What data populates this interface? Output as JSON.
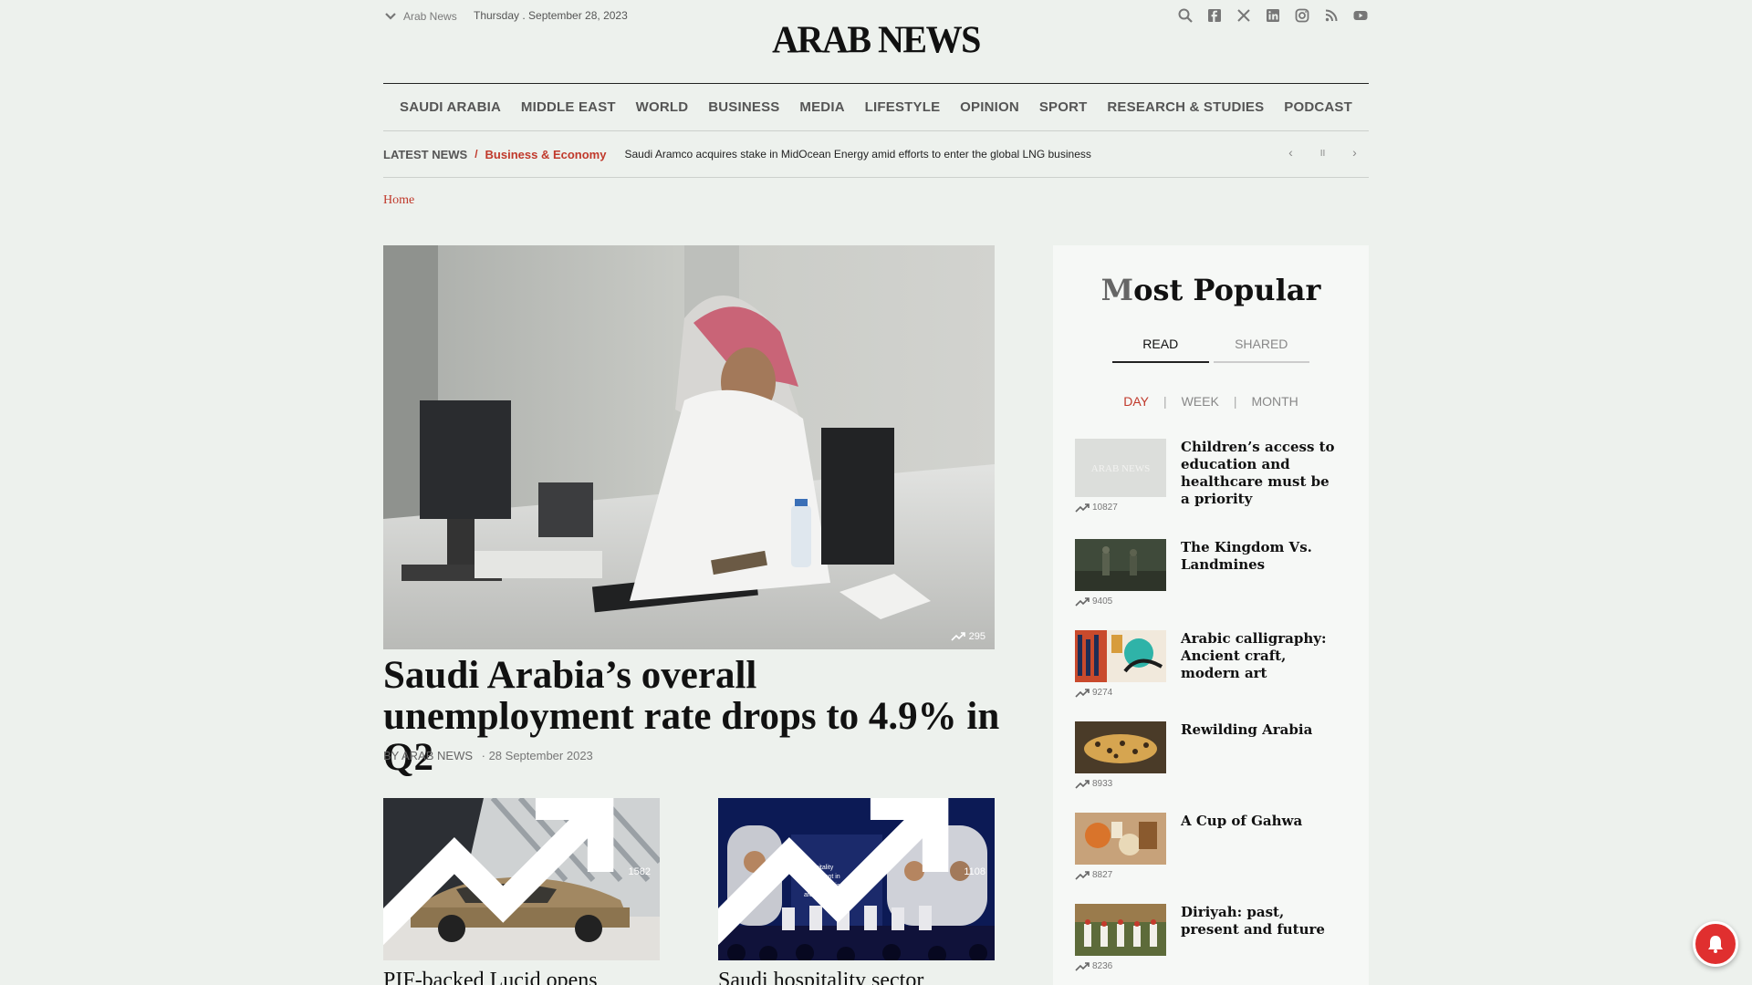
{
  "header": {
    "edition": "Arab News",
    "date": "Thursday .  September 28, 2023",
    "logo": "ARAB NEWS",
    "social_icons": [
      "search-icon",
      "facebook-icon",
      "x-icon",
      "linkedin-icon",
      "instagram-icon",
      "rss-icon",
      "youtube-icon"
    ]
  },
  "nav": {
    "items": [
      "SAUDI ARABIA",
      "MIDDLE EAST",
      "WORLD",
      "BUSINESS",
      "MEDIA",
      "LIFESTYLE",
      "OPINION",
      "SPORT",
      "RESEARCH & STUDIES",
      "PODCAST"
    ]
  },
  "ticker": {
    "label": "LATEST NEWS",
    "separator": "/",
    "category": "Business & Economy",
    "headline": "Saudi Aramco acquires stake in MidOcean Energy amid efforts to enter the global LNG business",
    "prev": "‹",
    "pause": "II",
    "next": "›"
  },
  "breadcrumb": "Home",
  "hero": {
    "views": "295",
    "title": "Saudi Arabia’s overall unemployment rate drops to 4.9% in Q2",
    "byline": "BY ARAB NEWS",
    "date": "· 28 September 2023"
  },
  "cards": [
    {
      "views": "1582",
      "title": "PIF-backed Lucid opens"
    },
    {
      "views": "1108",
      "title": "Saudi hospitality sector"
    }
  ],
  "sidebar": {
    "title_first": "M",
    "title_rest": "ost Popular",
    "tab_read": "READ",
    "tab_shared": "SHARED",
    "period_day": "DAY",
    "period_week": "WEEK",
    "period_month": "MONTH",
    "sep": "|",
    "placeholder_logo": "ARAB NEWS",
    "items": [
      {
        "title": "Children’s access to education and healthcare must be a priority",
        "count": "10827"
      },
      {
        "title": "The Kingdom Vs. Landmines",
        "count": "9405"
      },
      {
        "title": "Arabic calligraphy: Ancient craft, modern art",
        "count": "9274"
      },
      {
        "title": "Rewilding Arabia",
        "count": "8933"
      },
      {
        "title": "A Cup of Gahwa",
        "count": "8827"
      },
      {
        "title": "Diriyah: past, present and future",
        "count": "8236"
      }
    ]
  },
  "colors": {
    "accent": "#c0392b",
    "background": "#edf1ed"
  }
}
